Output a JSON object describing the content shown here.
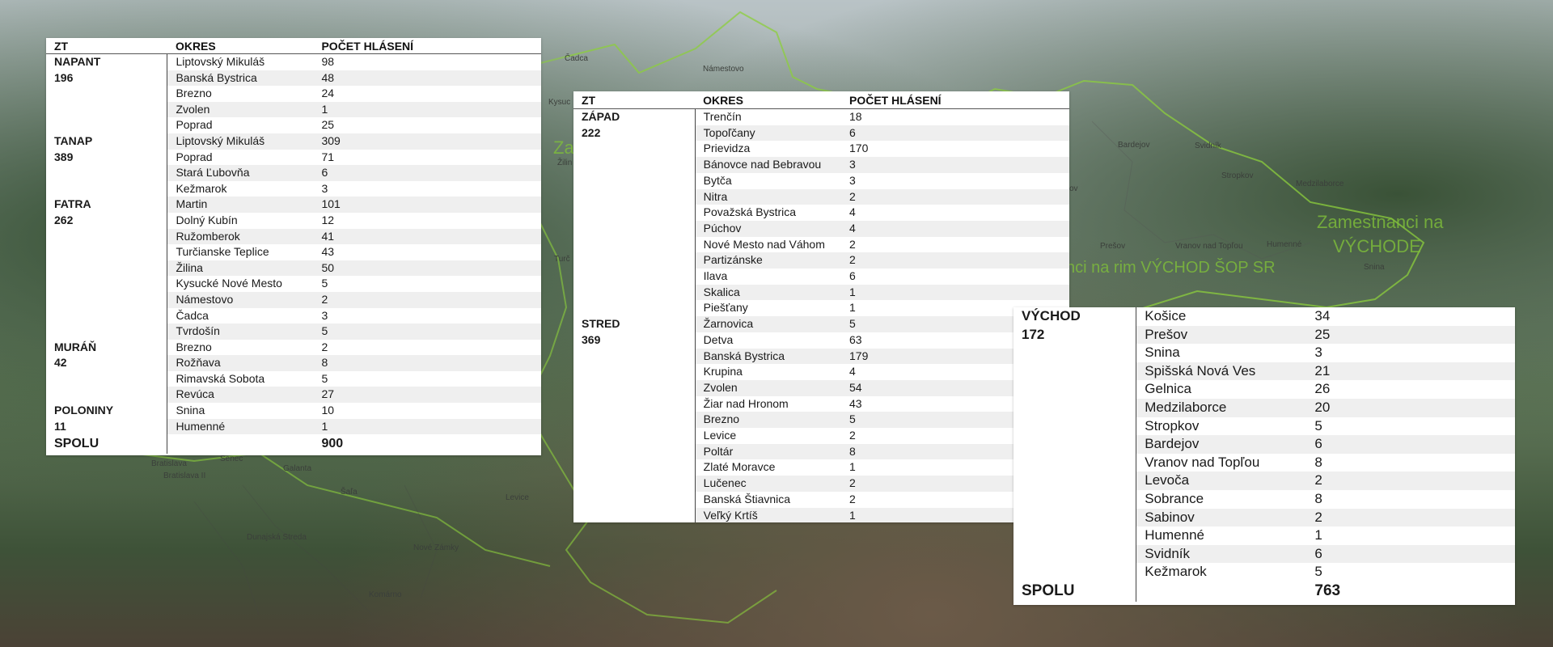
{
  "background": {
    "map_labels": [
      "Čadca",
      "Námestovo",
      "Bardejov",
      "Svidník",
      "Stropkov",
      "Medzilaborce",
      "Prešov",
      "Vranov nad Topľou",
      "Humenné",
      "Snina",
      "Senec",
      "Galanta",
      "Šaľa",
      "Levice",
      "Dunajská Streda",
      "Nové Zámky",
      "Komárno",
      "Bratislava",
      "Bratislava II",
      "Žilin",
      "Kysuc",
      "Turč",
      "ov"
    ],
    "watermark_1": "Zamestnanci na",
    "watermark_2": "VÝCHODE",
    "watermark_3": "nci na rim VÝCHOD ŠOP SR",
    "watermark_4": "Za"
  },
  "tables": {
    "t1": {
      "headers": [
        "ZT",
        "OKRES",
        "POČET HLÁSENÍ"
      ],
      "groups": [
        {
          "zt": "NAPANT",
          "total": "196",
          "rows": [
            [
              "Liptovský Mikuláš",
              "98"
            ],
            [
              "Banská Bystrica",
              "48"
            ],
            [
              "Brezno",
              "24"
            ],
            [
              "Zvolen",
              "1"
            ],
            [
              "Poprad",
              "25"
            ]
          ]
        },
        {
          "zt": "TANAP",
          "total": "389",
          "rows": [
            [
              "Liptovský Mikuláš",
              "309"
            ],
            [
              "Poprad",
              "71"
            ],
            [
              "Stará Ľubovňa",
              "6"
            ],
            [
              "Kežmarok",
              "3"
            ]
          ]
        },
        {
          "zt": "FATRA",
          "total": "262",
          "rows": [
            [
              "Martin",
              "101"
            ],
            [
              "Dolný Kubín",
              "12"
            ],
            [
              "Ružomberok",
              "41"
            ],
            [
              "Turčianske Teplice",
              "43"
            ],
            [
              "Žilina",
              "50"
            ],
            [
              "Kysucké Nové Mesto",
              "5"
            ],
            [
              "Námestovo",
              "2"
            ],
            [
              "Čadca",
              "3"
            ],
            [
              "Tvrdošín",
              "5"
            ]
          ]
        },
        {
          "zt": "MURÁŇ",
          "total": "42",
          "rows": [
            [
              "Brezno",
              "2"
            ],
            [
              "Rožňava",
              "8"
            ],
            [
              "Rimavská Sobota",
              "5"
            ],
            [
              "Revúca",
              "27"
            ]
          ]
        },
        {
          "zt": "POLONINY",
          "total": "11",
          "rows": [
            [
              "Snina",
              "10"
            ],
            [
              "Humenné",
              "1"
            ]
          ]
        }
      ],
      "footer": {
        "label": "SPOLU",
        "value": "900"
      }
    },
    "t2": {
      "headers": [
        "ZT",
        "OKRES",
        "POČET HLÁSENÍ"
      ],
      "groups": [
        {
          "zt": "ZÁPAD",
          "total": "222",
          "rows": [
            [
              "Trenčín",
              "18"
            ],
            [
              "Topoľčany",
              "6"
            ],
            [
              "Prievidza",
              "170"
            ],
            [
              "Bánovce nad Bebravou",
              "3"
            ],
            [
              "Bytča",
              "3"
            ],
            [
              "Nitra",
              "2"
            ],
            [
              "Považská Bystrica",
              "4"
            ],
            [
              "Púchov",
              "4"
            ],
            [
              "Nové Mesto nad Váhom",
              "2"
            ],
            [
              "Partizánske",
              "2"
            ],
            [
              "Ilava",
              "6"
            ],
            [
              "Skalica",
              "1"
            ],
            [
              "Piešťany",
              "1"
            ]
          ]
        },
        {
          "zt": "STRED",
          "total": "369",
          "rows": [
            [
              "Žarnovica",
              "5"
            ],
            [
              "Detva",
              "63"
            ],
            [
              "Banská Bystrica",
              "179"
            ],
            [
              "Krupina",
              "4"
            ],
            [
              "Zvolen",
              "54"
            ],
            [
              "Žiar nad Hronom",
              "43"
            ],
            [
              "Brezno",
              "5"
            ],
            [
              "Levice",
              "2"
            ],
            [
              "Poltár",
              "8"
            ],
            [
              "Zlaté Moravce",
              "1"
            ],
            [
              "Lučenec",
              "2"
            ],
            [
              "Banská Štiavnica",
              "2"
            ],
            [
              "Veľký Krtíš",
              "1"
            ]
          ]
        }
      ]
    },
    "t3": {
      "groups": [
        {
          "zt": "VÝCHOD",
          "total": "172",
          "rows": [
            [
              "Košice",
              "34"
            ],
            [
              "Prešov",
              "25"
            ],
            [
              "Snina",
              "3"
            ],
            [
              "Spišská Nová Ves",
              "21"
            ],
            [
              "Gelnica",
              "26"
            ],
            [
              "Medzilaborce",
              "20"
            ],
            [
              "Stropkov",
              "5"
            ],
            [
              "Bardejov",
              "6"
            ],
            [
              "Vranov nad Topľou",
              "8"
            ],
            [
              "Levoča",
              "2"
            ],
            [
              "Sobrance",
              "8"
            ],
            [
              "Sabinov",
              "2"
            ],
            [
              "Humenné",
              "1"
            ],
            [
              "Svidník",
              "6"
            ],
            [
              "Kežmarok",
              "5"
            ]
          ]
        }
      ],
      "footer": {
        "label": "SPOLU",
        "value": "763"
      }
    }
  }
}
